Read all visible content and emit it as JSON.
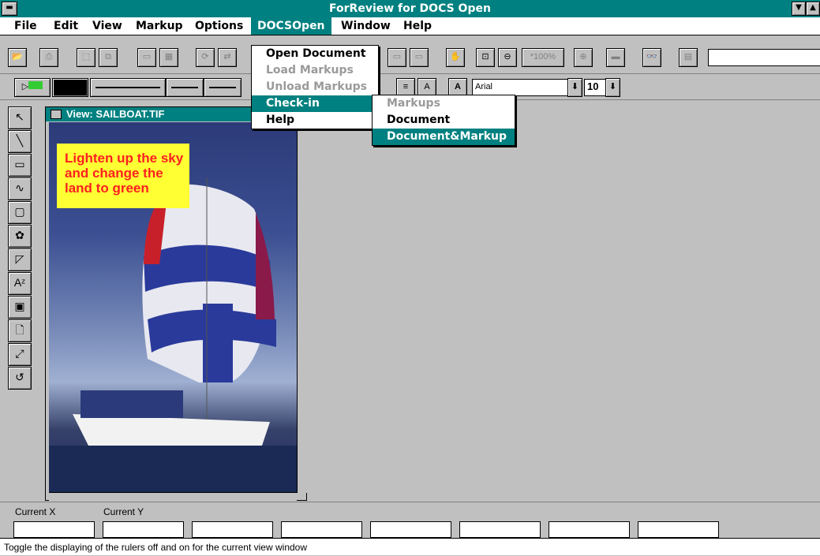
{
  "window": {
    "title": "ForReview for DOCS Open"
  },
  "menubar": [
    {
      "label": "File"
    },
    {
      "label": "Edit"
    },
    {
      "label": "View"
    },
    {
      "label": "Markup"
    },
    {
      "label": "Options"
    },
    {
      "label": "DOCSOpen"
    },
    {
      "label": "Window"
    },
    {
      "label": "Help"
    }
  ],
  "docsopen_menu": {
    "items": [
      {
        "label": "Open Document",
        "enabled": true
      },
      {
        "label": "Load Markups",
        "enabled": false
      },
      {
        "label": "Unload Markups",
        "enabled": false
      },
      {
        "label": "Check-in",
        "enabled": true
      },
      {
        "label": "Help",
        "enabled": true
      }
    ]
  },
  "checkin_submenu": {
    "items": [
      {
        "label": "Markups",
        "enabled": false
      },
      {
        "label": "Document",
        "enabled": true
      },
      {
        "label": "Document&Markup",
        "enabled": true
      }
    ]
  },
  "toolbar": {
    "zoom_label": "*100%",
    "font_name": "Arial",
    "font_size": "10"
  },
  "document": {
    "title": "View: SAILBOAT.TIF",
    "note": "Lighten up the sky and change the land to green"
  },
  "status": {
    "current_x_label": "Current X",
    "current_y_label": "Current Y",
    "message": "Toggle the displaying of the rulers off and on for the current view window"
  },
  "colors": {
    "titlebar": "#008080",
    "note_bg": "#ffff33",
    "note_text": "#ff2020"
  }
}
